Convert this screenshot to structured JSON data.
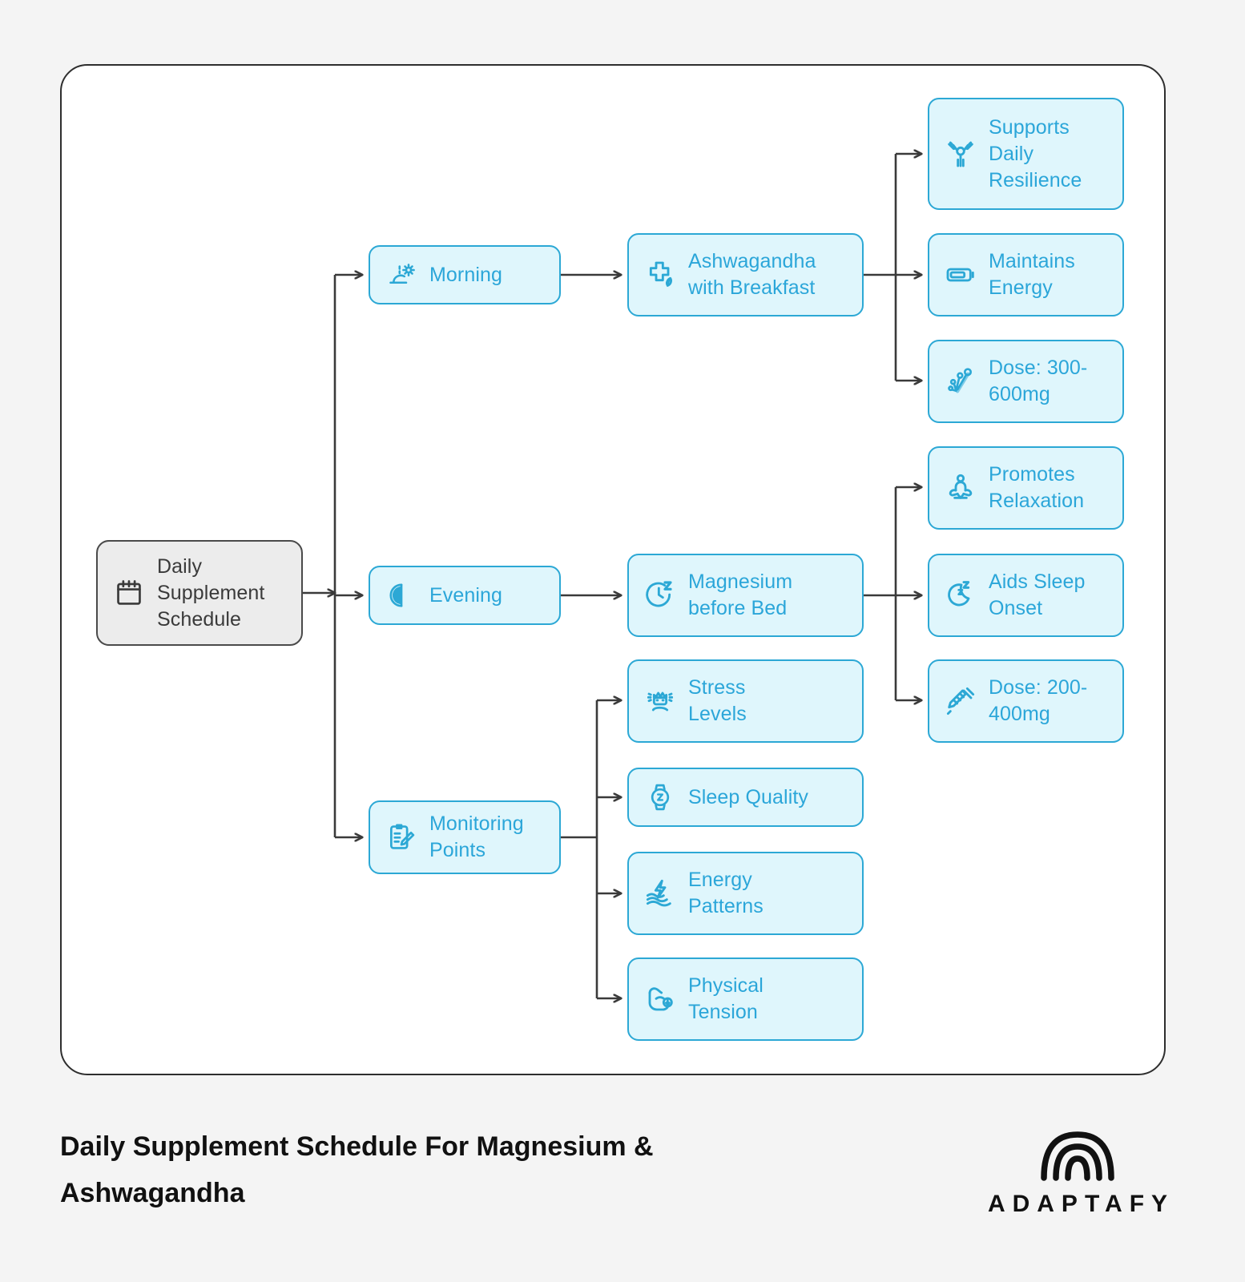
{
  "theme": {
    "page_bg": "#f4f4f4",
    "card_bg": "#ffffff",
    "card_border": "#2e2e2e",
    "node_fill": "#dff6fc",
    "node_border": "#2ca8d5",
    "node_text": "#2ba6d9",
    "root_fill": "#ececec",
    "root_border": "#4a4a4a",
    "root_text": "#3a3a3a",
    "connector": "#3a3a3a",
    "footer_text": "#111111"
  },
  "diagram": {
    "root": {
      "label": "Daily\nSupplement\nSchedule",
      "icon": "calendar-icon"
    },
    "branches": [
      {
        "key": "morning",
        "label": "Morning",
        "icon": "sunrise-icon",
        "detail": {
          "label": "Ashwagandha\nwith Breakfast",
          "icon": "medical-cross-leaf-icon"
        },
        "outcomes": [
          {
            "label": "Supports\nDaily\nResilience",
            "icon": "weightlifter-icon"
          },
          {
            "label": "Maintains\nEnergy",
            "icon": "battery-icon"
          },
          {
            "label": "Dose: 300-\n600mg",
            "icon": "molecule-icon"
          }
        ]
      },
      {
        "key": "evening",
        "label": "Evening",
        "icon": "half-moon-icon",
        "detail": {
          "label": "Magnesium\nbefore Bed",
          "icon": "clock-sleep-icon"
        },
        "outcomes": [
          {
            "label": "Promotes\nRelaxation",
            "icon": "meditation-icon"
          },
          {
            "label": "Aids Sleep\nOnset",
            "icon": "moon-zzz-icon"
          },
          {
            "label": "Dose: 200-\n400mg",
            "icon": "syringe-icon"
          }
        ]
      },
      {
        "key": "monitoring",
        "label": "Monitoring\nPoints",
        "icon": "clipboard-pencil-icon",
        "items": [
          {
            "label": "Stress\nLevels",
            "icon": "stressed-face-icon"
          },
          {
            "label": "Sleep Quality",
            "icon": "smartwatch-icon"
          },
          {
            "label": "Energy\nPatterns",
            "icon": "energy-waves-icon"
          },
          {
            "label": "Physical\nTension",
            "icon": "flexed-arm-icon"
          }
        ]
      }
    ]
  },
  "footer": {
    "title": "Daily Supplement Schedule For Magnesium &\nAshwagandha",
    "brand": {
      "name": "ADAPTAFY",
      "logo": "adaptafy-arch-logo"
    }
  }
}
